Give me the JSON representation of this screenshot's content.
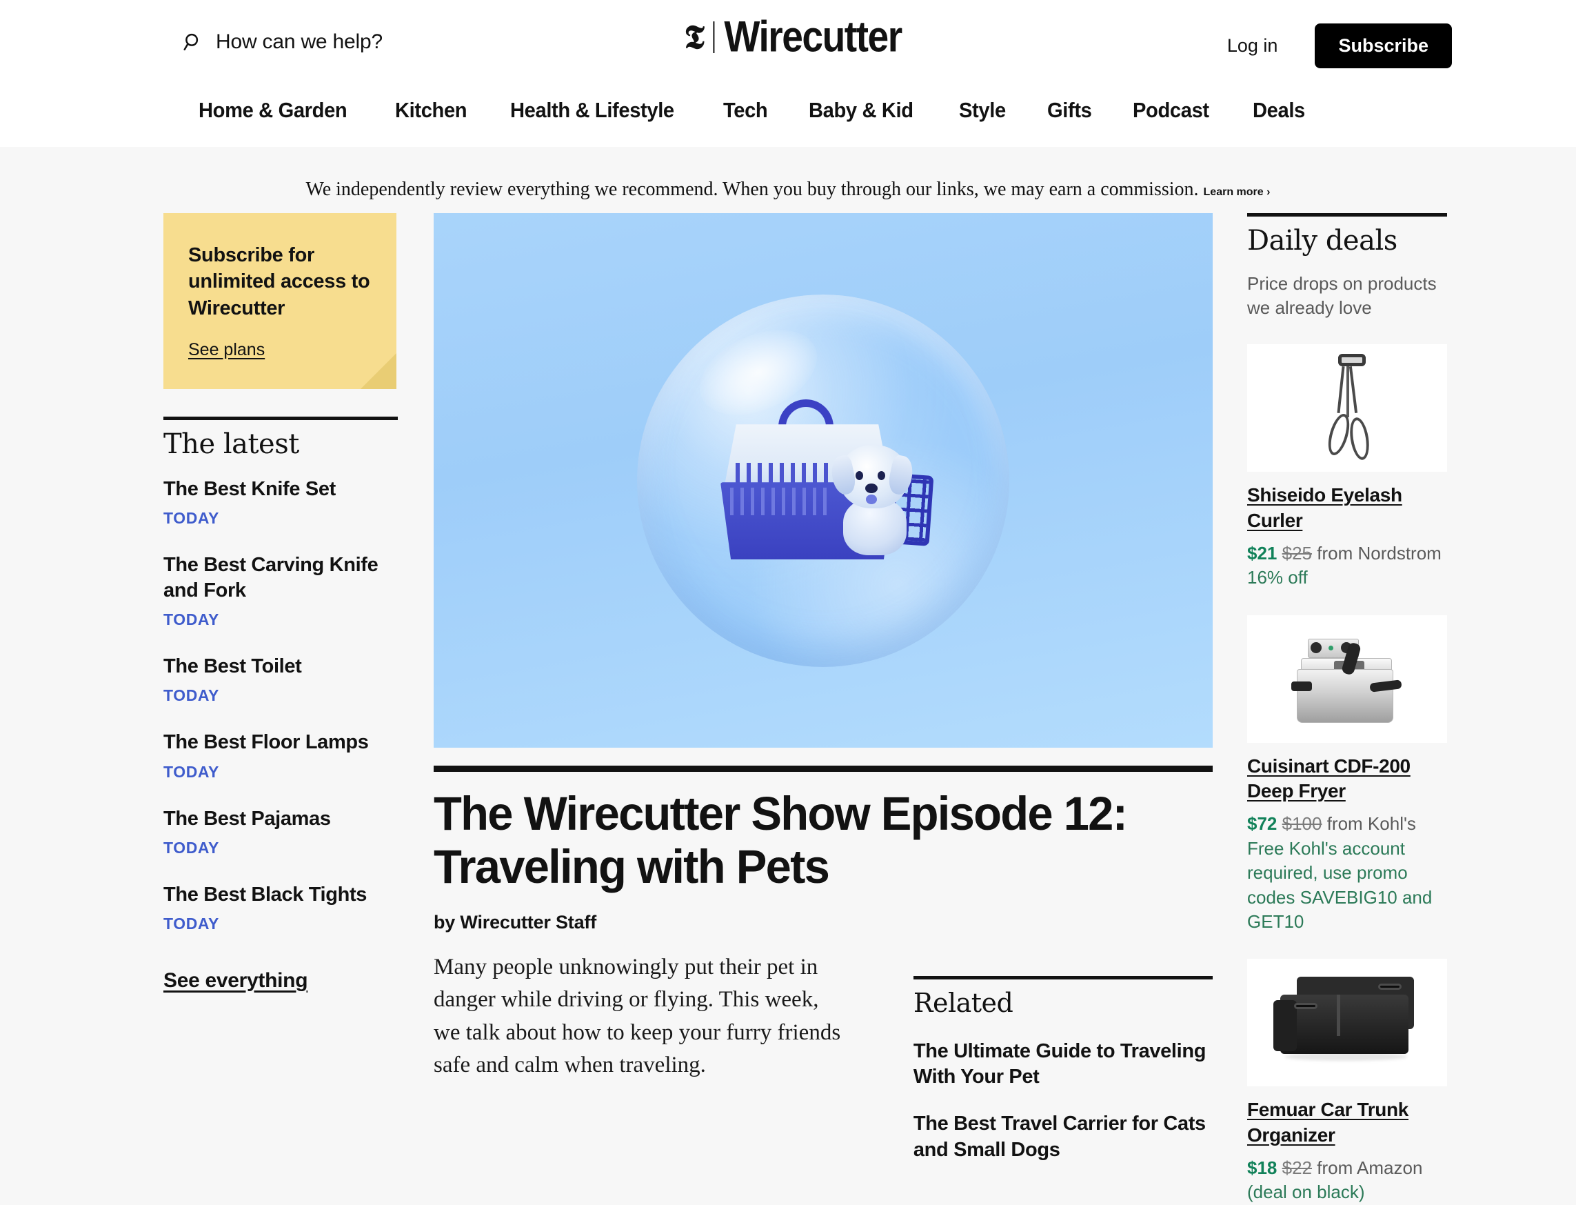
{
  "header": {
    "search": {
      "placeholder": "How can we help?",
      "icon": "search-icon"
    },
    "logo": {
      "mark": "𝕿",
      "wordmark": "Wirecutter"
    },
    "login_label": "Log in",
    "subscribe_label": "Subscribe",
    "nav": [
      {
        "label": "Home & Garden"
      },
      {
        "label": "Kitchen"
      },
      {
        "label": "Health & Lifestyle"
      },
      {
        "label": "Tech"
      },
      {
        "label": "Baby & Kid"
      },
      {
        "label": "Style"
      },
      {
        "label": "Gifts"
      },
      {
        "label": "Podcast"
      },
      {
        "label": "Deals"
      }
    ]
  },
  "disclaimer": {
    "text": "We independently review everything we recommend. When you buy through our links, we may earn a commission. ",
    "link": "Learn more ›"
  },
  "sidebar_left": {
    "promo": {
      "title": "Subscribe for unlimited access to Wirecutter",
      "link": "See plans",
      "bg_color": "#f7dd8f"
    },
    "latest": {
      "section_title": "The latest",
      "items": [
        {
          "title": "The Best Knife Set",
          "date": "TODAY"
        },
        {
          "title": "The Best Carving Knife and Fork",
          "date": "TODAY"
        },
        {
          "title": "The Best Toilet",
          "date": "TODAY"
        },
        {
          "title": "The Best Floor Lamps",
          "date": "TODAY"
        },
        {
          "title": "The Best Pajamas",
          "date": "TODAY"
        },
        {
          "title": "The Best Black Tights",
          "date": "TODAY"
        }
      ],
      "see_all": "See everything",
      "date_color": "#3f5ccc"
    }
  },
  "article": {
    "hero_alt": "Dog in a blue pet carrier floating inside a translucent bubble on a light blue background",
    "headline": "The Wirecutter Show Episode 12: Traveling with Pets",
    "byline": "by Wirecutter Staff",
    "dek": "Many people unknowingly put their pet in danger while driving or flying. This week, we talk about how to keep your furry friends safe and calm when traveling."
  },
  "related": {
    "section_title": "Related",
    "items": [
      {
        "title": "The Ultimate Guide to Traveling With Your Pet"
      },
      {
        "title": "The Best Travel Carrier for Cats and Small Dogs"
      }
    ]
  },
  "daily_deals": {
    "section_title": "Daily deals",
    "subtitle": "Price drops on products we already love",
    "price_color": "#12825a",
    "deals": [
      {
        "image": "eyelash-curler-photo",
        "title": "Shiseido Eyelash Curler",
        "price_now": "$21",
        "price_was": "$25",
        "retailer": "from Nordstrom",
        "note": "16% off"
      },
      {
        "image": "deep-fryer-photo",
        "title": "Cuisinart CDF-200 Deep Fryer",
        "price_now": "$72",
        "price_was": "$100",
        "retailer": "from Kohl's",
        "note": "Free Kohl's account required, use promo codes SAVEBIG10 and GET10"
      },
      {
        "image": "car-trunk-organizer-photo",
        "title": "Femuar Car Trunk Organizer",
        "price_now": "$18",
        "price_was": "$22",
        "retailer": "from Amazon",
        "note": "(deal on black)"
      }
    ]
  }
}
